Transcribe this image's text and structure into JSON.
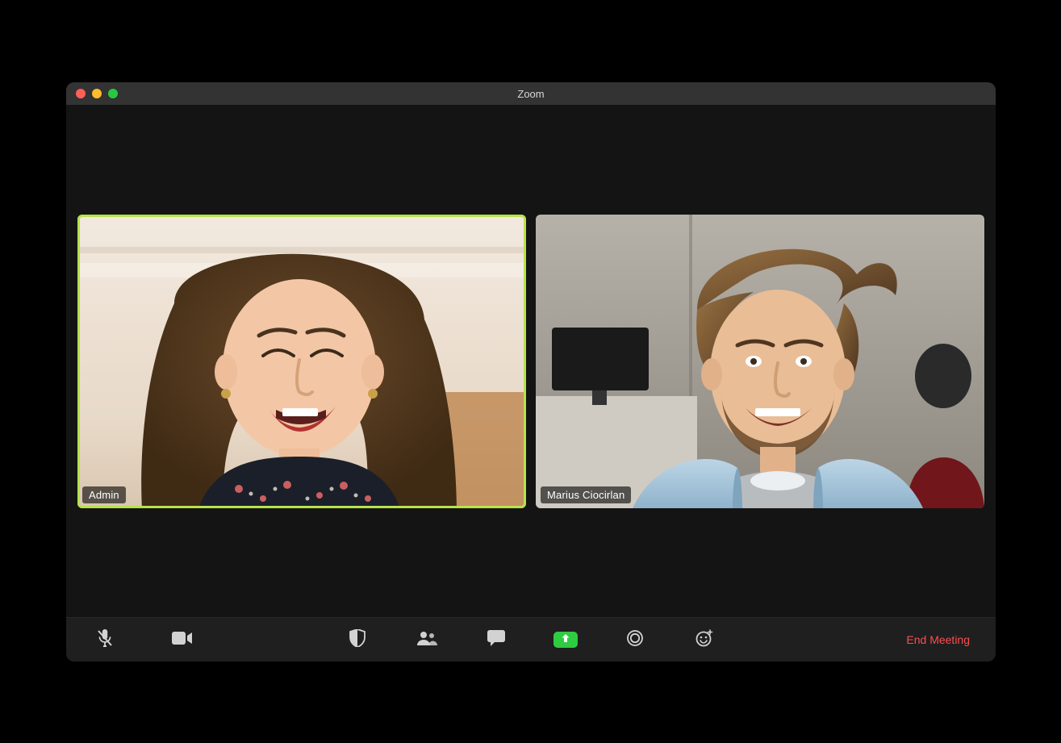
{
  "window": {
    "title": "Zoom"
  },
  "participants": [
    {
      "name": "Admin",
      "active_speaker": true
    },
    {
      "name": "Marius Ciocirlan",
      "active_speaker": false
    }
  ],
  "toolbar": {
    "mute_label": "Mute",
    "video_label": "Stop Video",
    "security_label": "Security",
    "participants_label": "Participants",
    "chat_label": "Chat",
    "share_label": "Share Screen",
    "record_label": "Record",
    "reactions_label": "Reactions",
    "end_label": "End Meeting"
  },
  "colors": {
    "active_speaker_outline": "#b7e24b",
    "share_button_bg": "#2ecc40",
    "end_meeting_text": "#ff4d4f"
  }
}
